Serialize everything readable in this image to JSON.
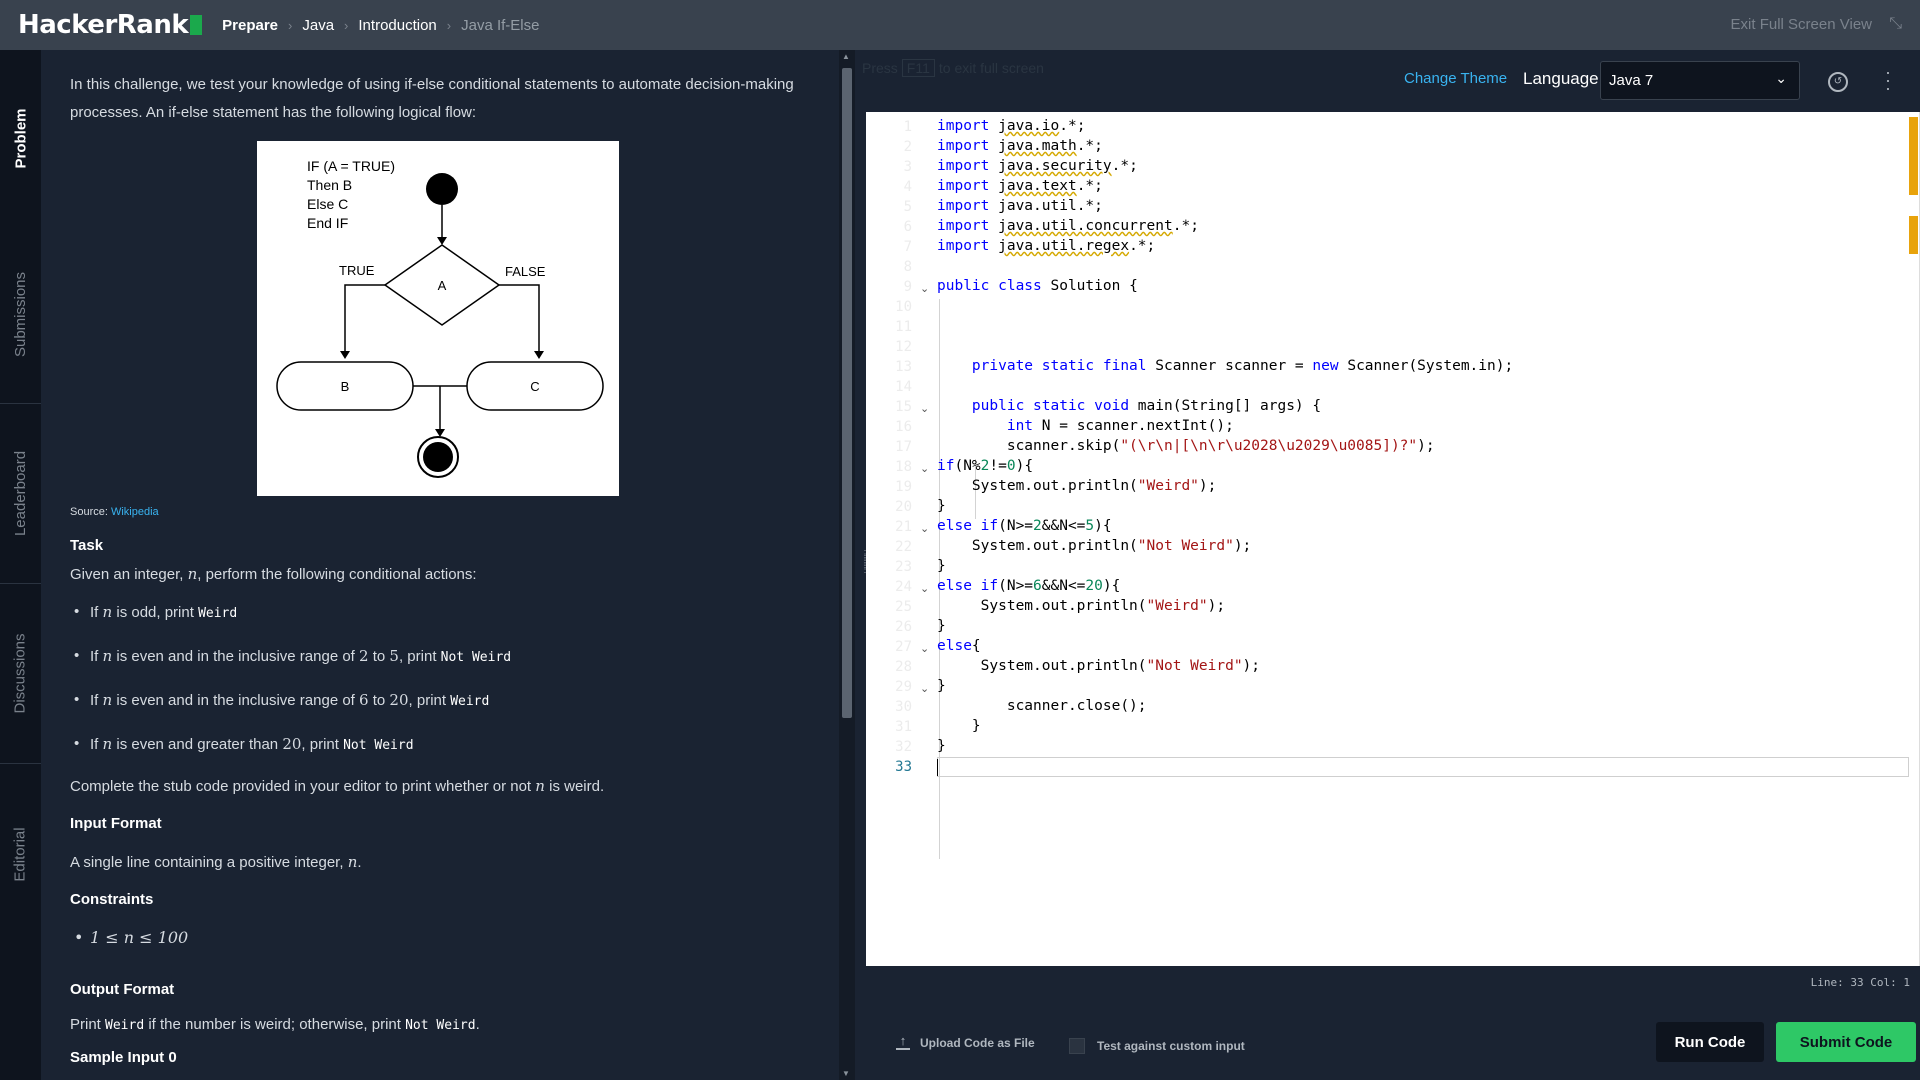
{
  "header": {
    "logo": "HackerRank",
    "breadcrumbs": [
      "Prepare",
      "Java",
      "Introduction",
      "Java If-Else"
    ],
    "exit_label": "Exit Full Screen View"
  },
  "side_tabs": [
    "Problem",
    "Submissions",
    "Leaderboard",
    "Discussions",
    "Editorial"
  ],
  "problem": {
    "intro": "In this challenge, we test your knowledge of using if-else conditional statements to automate decision-making processes. An if-else statement has the following logical flow:",
    "diagram": {
      "pseudo": [
        "IF (A = TRUE)",
        "Then B",
        "Else C",
        "End IF"
      ],
      "decision": "A",
      "true_label": "TRUE",
      "false_label": "FALSE",
      "node_b": "B",
      "node_c": "C"
    },
    "source_prefix": "Source: ",
    "source_link": "Wikipedia",
    "task_heading": "Task",
    "task_intro_a": "Given an integer, ",
    "task_intro_b": ", perform the following conditional actions:",
    "n": "n",
    "bullets": [
      {
        "a": "If ",
        "b": " is odd, print ",
        "code": "Weird"
      },
      {
        "a": "If ",
        "b": " is even and in the inclusive range of ",
        "lo": "2",
        "mid": " to ",
        "hi": "5",
        "c": ", print ",
        "code": "Not Weird"
      },
      {
        "a": "If ",
        "b": " is even and in the inclusive range of ",
        "lo": "6",
        "mid": " to ",
        "hi": "20",
        "c": ", print ",
        "code": "Weird"
      },
      {
        "a": "If ",
        "b": " is even and greater than ",
        "lo": "20",
        "c": ", print ",
        "code": "Not Weird"
      }
    ],
    "complete_a": "Complete the stub code provided in your editor to print whether or not ",
    "complete_b": " is weird.",
    "input_heading": "Input Format",
    "input_a": "A single line containing a positive integer, ",
    "input_b": ".",
    "constraints_heading": "Constraints",
    "constraint": "1 ≤ n ≤ 100",
    "output_heading": "Output Format",
    "output_a": "Print ",
    "output_code1": "Weird",
    "output_b": " if the number is weird; otherwise, print ",
    "output_code2": "Not Weird",
    "output_c": ".",
    "sample_heading": "Sample Input 0"
  },
  "editor": {
    "fullscreen_note_a": "Press",
    "fullscreen_key": "F11",
    "fullscreen_note_b": "to exit full screen",
    "change_theme": "Change Theme",
    "language_label": "Language",
    "language_value": "Java 7",
    "current_line_number": "33",
    "status": "Line: 33 Col: 1",
    "upload_label": "Upload Code as File",
    "custom_input_label": "Test against custom input",
    "run_label": "Run Code",
    "submit_label": "Submit Code"
  }
}
